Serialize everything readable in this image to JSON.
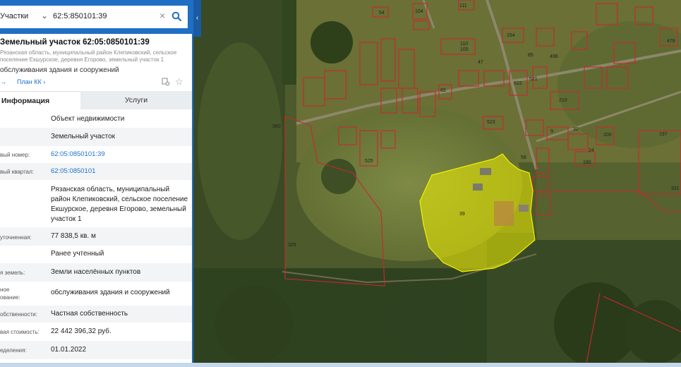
{
  "search": {
    "type_label": "Участки",
    "query": "62:5:850101:39"
  },
  "object": {
    "title": "Земельный участок 62:05:0850101:39",
    "address_short": "Рязанская область, муниципальный район Клепиковский, сельское поселение Екшурское, деревня Егорово, земельный участок 1",
    "purpose_short": "обслуживания здания и сооружений",
    "link_left": "→",
    "link_plan": "План КК"
  },
  "tabs": {
    "info": "Информация",
    "services": "Услуги"
  },
  "info_rows": [
    {
      "label": "",
      "value": "Объект недвижимости"
    },
    {
      "label": "",
      "value": "Земельный участок"
    },
    {
      "label": "вый номер:",
      "value": "62:05:0850101:39"
    },
    {
      "label": "вый квартал:",
      "value": "62:05:0850101"
    },
    {
      "label": "",
      "value": "Рязанская область, муниципальный район Клепиковский, сельское поселение Екшурское, деревня Егорово, земельный участок 1"
    },
    {
      "label": "уточненная:",
      "value": "77 838,5 кв. м"
    },
    {
      "label": "",
      "value": "Ранее учтенный"
    },
    {
      "label": "я земель:",
      "value": "Земли населённых пунктов"
    },
    {
      "label": "ное ование:",
      "value": "обслуживания здания и сооружений"
    },
    {
      "label": "обственности:",
      "value": "Частная собственность"
    },
    {
      "label": "вая стоимость:",
      "value": "22 442 396,32 руб."
    },
    {
      "label": "еделения:",
      "value": "01.01.2022"
    }
  ],
  "map_labels": {
    "selected_parcel": "39",
    "p360": "360",
    "p325": "325",
    "p197": "197",
    "p331": "331",
    "p210": "210",
    "p523": "523",
    "p58": "58",
    "p200": "200",
    "p190": "190",
    "p24": "24",
    "p9": "9",
    "p32": "32",
    "p65": "65",
    "p525": "525",
    "p154": "154",
    "p521": "521",
    "p522": "522",
    "p47": "47",
    "p54": "54",
    "p104": "104",
    "p111": "111",
    "p110": "110",
    "p496": "496",
    "p478": "478",
    "p85": "85",
    "p105": "105"
  },
  "colors": {
    "sidebar_blue": "#1f6fc4",
    "link_blue": "#1e73c8",
    "parcel_outline": "#c8282e",
    "selected_fill": "#f2f200"
  }
}
